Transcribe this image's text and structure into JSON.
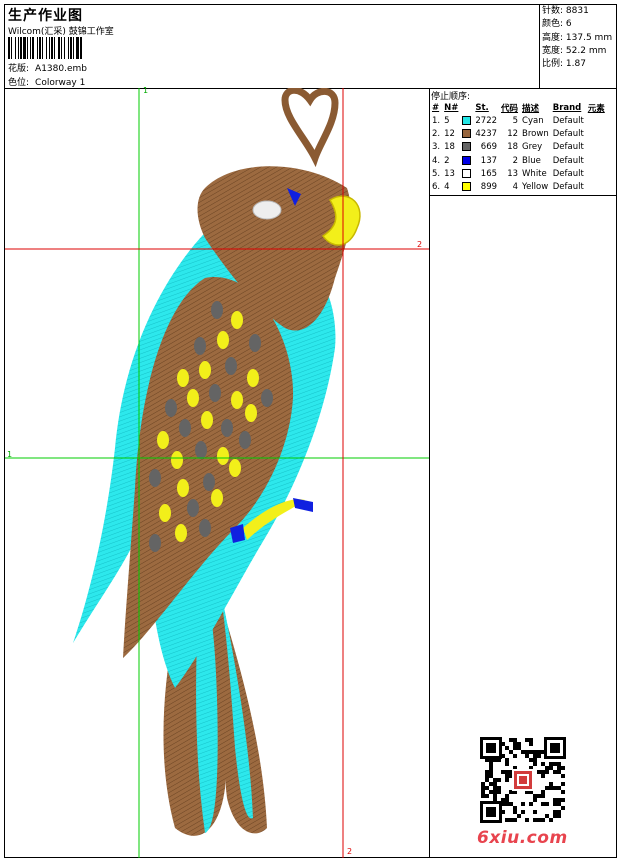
{
  "header": {
    "title": "生产作业图",
    "company": "Wilcom(汇采) 鼓锦工作室",
    "file_label": "花版:",
    "file_name": "A1380.emb",
    "colorway_label": "色位:",
    "colorway_name": "Colorway 1"
  },
  "stats": [
    {
      "label": "针数:",
      "value": "8831"
    },
    {
      "label": "颜色:",
      "value": "6"
    },
    {
      "label": "高度:",
      "value": "137.5 mm"
    },
    {
      "label": "宽度:",
      "value": "52.2 mm"
    },
    {
      "label": "比例:",
      "value": "1.87"
    }
  ],
  "sequence": {
    "title": "停止顺序:",
    "headers": [
      "#",
      "N#",
      "St.",
      "代码",
      "描述",
      "Brand",
      "元素"
    ],
    "rows": [
      {
        "idx": "1.",
        "n": "5",
        "color": "#22e6e6",
        "st": "2722",
        "code": "5",
        "desc": "Cyan",
        "brand": "Default"
      },
      {
        "idx": "2.",
        "n": "12",
        "color": "#96643c",
        "st": "4237",
        "code": "12",
        "desc": "Brown",
        "brand": "Default"
      },
      {
        "idx": "3.",
        "n": "18",
        "color": "#646464",
        "st": "669",
        "code": "18",
        "desc": "Grey",
        "brand": "Default"
      },
      {
        "idx": "4.",
        "n": "2",
        "color": "#0000e6",
        "st": "137",
        "code": "2",
        "desc": "Blue",
        "brand": "Default"
      },
      {
        "idx": "5.",
        "n": "13",
        "color": "#ffffff",
        "st": "165",
        "code": "13",
        "desc": "White",
        "brand": "Default"
      },
      {
        "idx": "6.",
        "n": "4",
        "color": "#ffff00",
        "st": "899",
        "code": "4",
        "desc": "Yellow",
        "brand": "Default"
      }
    ]
  },
  "guides": {
    "marker_1": "1",
    "marker_2": "2"
  },
  "watermark": "6xiu.com",
  "colors": {
    "guide_green": "#00cc00",
    "guide_red": "#dd0000"
  }
}
